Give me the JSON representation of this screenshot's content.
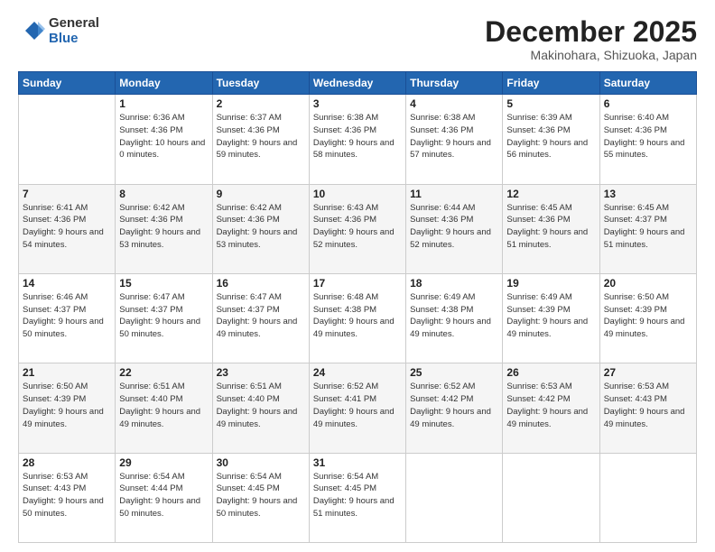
{
  "logo": {
    "general": "General",
    "blue": "Blue"
  },
  "header": {
    "month": "December 2025",
    "location": "Makinohara, Shizuoka, Japan"
  },
  "weekdays": [
    "Sunday",
    "Monday",
    "Tuesday",
    "Wednesday",
    "Thursday",
    "Friday",
    "Saturday"
  ],
  "weeks": [
    [
      {
        "day": "",
        "sunrise": "",
        "sunset": "",
        "daylight": ""
      },
      {
        "day": "1",
        "sunrise": "Sunrise: 6:36 AM",
        "sunset": "Sunset: 4:36 PM",
        "daylight": "Daylight: 10 hours and 0 minutes."
      },
      {
        "day": "2",
        "sunrise": "Sunrise: 6:37 AM",
        "sunset": "Sunset: 4:36 PM",
        "daylight": "Daylight: 9 hours and 59 minutes."
      },
      {
        "day": "3",
        "sunrise": "Sunrise: 6:38 AM",
        "sunset": "Sunset: 4:36 PM",
        "daylight": "Daylight: 9 hours and 58 minutes."
      },
      {
        "day": "4",
        "sunrise": "Sunrise: 6:38 AM",
        "sunset": "Sunset: 4:36 PM",
        "daylight": "Daylight: 9 hours and 57 minutes."
      },
      {
        "day": "5",
        "sunrise": "Sunrise: 6:39 AM",
        "sunset": "Sunset: 4:36 PM",
        "daylight": "Daylight: 9 hours and 56 minutes."
      },
      {
        "day": "6",
        "sunrise": "Sunrise: 6:40 AM",
        "sunset": "Sunset: 4:36 PM",
        "daylight": "Daylight: 9 hours and 55 minutes."
      }
    ],
    [
      {
        "day": "7",
        "sunrise": "Sunrise: 6:41 AM",
        "sunset": "Sunset: 4:36 PM",
        "daylight": "Daylight: 9 hours and 54 minutes."
      },
      {
        "day": "8",
        "sunrise": "Sunrise: 6:42 AM",
        "sunset": "Sunset: 4:36 PM",
        "daylight": "Daylight: 9 hours and 53 minutes."
      },
      {
        "day": "9",
        "sunrise": "Sunrise: 6:42 AM",
        "sunset": "Sunset: 4:36 PM",
        "daylight": "Daylight: 9 hours and 53 minutes."
      },
      {
        "day": "10",
        "sunrise": "Sunrise: 6:43 AM",
        "sunset": "Sunset: 4:36 PM",
        "daylight": "Daylight: 9 hours and 52 minutes."
      },
      {
        "day": "11",
        "sunrise": "Sunrise: 6:44 AM",
        "sunset": "Sunset: 4:36 PM",
        "daylight": "Daylight: 9 hours and 52 minutes."
      },
      {
        "day": "12",
        "sunrise": "Sunrise: 6:45 AM",
        "sunset": "Sunset: 4:36 PM",
        "daylight": "Daylight: 9 hours and 51 minutes."
      },
      {
        "day": "13",
        "sunrise": "Sunrise: 6:45 AM",
        "sunset": "Sunset: 4:37 PM",
        "daylight": "Daylight: 9 hours and 51 minutes."
      }
    ],
    [
      {
        "day": "14",
        "sunrise": "Sunrise: 6:46 AM",
        "sunset": "Sunset: 4:37 PM",
        "daylight": "Daylight: 9 hours and 50 minutes."
      },
      {
        "day": "15",
        "sunrise": "Sunrise: 6:47 AM",
        "sunset": "Sunset: 4:37 PM",
        "daylight": "Daylight: 9 hours and 50 minutes."
      },
      {
        "day": "16",
        "sunrise": "Sunrise: 6:47 AM",
        "sunset": "Sunset: 4:37 PM",
        "daylight": "Daylight: 9 hours and 49 minutes."
      },
      {
        "day": "17",
        "sunrise": "Sunrise: 6:48 AM",
        "sunset": "Sunset: 4:38 PM",
        "daylight": "Daylight: 9 hours and 49 minutes."
      },
      {
        "day": "18",
        "sunrise": "Sunrise: 6:49 AM",
        "sunset": "Sunset: 4:38 PM",
        "daylight": "Daylight: 9 hours and 49 minutes."
      },
      {
        "day": "19",
        "sunrise": "Sunrise: 6:49 AM",
        "sunset": "Sunset: 4:39 PM",
        "daylight": "Daylight: 9 hours and 49 minutes."
      },
      {
        "day": "20",
        "sunrise": "Sunrise: 6:50 AM",
        "sunset": "Sunset: 4:39 PM",
        "daylight": "Daylight: 9 hours and 49 minutes."
      }
    ],
    [
      {
        "day": "21",
        "sunrise": "Sunrise: 6:50 AM",
        "sunset": "Sunset: 4:39 PM",
        "daylight": "Daylight: 9 hours and 49 minutes."
      },
      {
        "day": "22",
        "sunrise": "Sunrise: 6:51 AM",
        "sunset": "Sunset: 4:40 PM",
        "daylight": "Daylight: 9 hours and 49 minutes."
      },
      {
        "day": "23",
        "sunrise": "Sunrise: 6:51 AM",
        "sunset": "Sunset: 4:40 PM",
        "daylight": "Daylight: 9 hours and 49 minutes."
      },
      {
        "day": "24",
        "sunrise": "Sunrise: 6:52 AM",
        "sunset": "Sunset: 4:41 PM",
        "daylight": "Daylight: 9 hours and 49 minutes."
      },
      {
        "day": "25",
        "sunrise": "Sunrise: 6:52 AM",
        "sunset": "Sunset: 4:42 PM",
        "daylight": "Daylight: 9 hours and 49 minutes."
      },
      {
        "day": "26",
        "sunrise": "Sunrise: 6:53 AM",
        "sunset": "Sunset: 4:42 PM",
        "daylight": "Daylight: 9 hours and 49 minutes."
      },
      {
        "day": "27",
        "sunrise": "Sunrise: 6:53 AM",
        "sunset": "Sunset: 4:43 PM",
        "daylight": "Daylight: 9 hours and 49 minutes."
      }
    ],
    [
      {
        "day": "28",
        "sunrise": "Sunrise: 6:53 AM",
        "sunset": "Sunset: 4:43 PM",
        "daylight": "Daylight: 9 hours and 50 minutes."
      },
      {
        "day": "29",
        "sunrise": "Sunrise: 6:54 AM",
        "sunset": "Sunset: 4:44 PM",
        "daylight": "Daylight: 9 hours and 50 minutes."
      },
      {
        "day": "30",
        "sunrise": "Sunrise: 6:54 AM",
        "sunset": "Sunset: 4:45 PM",
        "daylight": "Daylight: 9 hours and 50 minutes."
      },
      {
        "day": "31",
        "sunrise": "Sunrise: 6:54 AM",
        "sunset": "Sunset: 4:45 PM",
        "daylight": "Daylight: 9 hours and 51 minutes."
      },
      {
        "day": "",
        "sunrise": "",
        "sunset": "",
        "daylight": ""
      },
      {
        "day": "",
        "sunrise": "",
        "sunset": "",
        "daylight": ""
      },
      {
        "day": "",
        "sunrise": "",
        "sunset": "",
        "daylight": ""
      }
    ]
  ]
}
